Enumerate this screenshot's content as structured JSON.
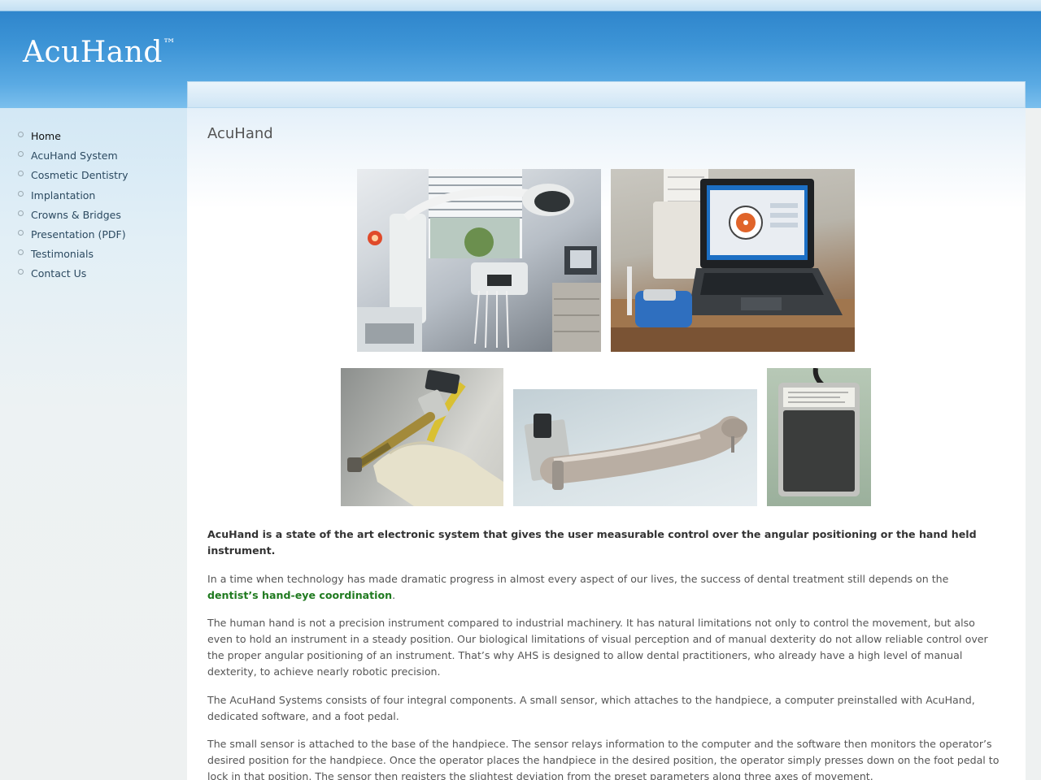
{
  "site": {
    "logo_text": "AcuHand",
    "logo_tm": "™"
  },
  "nav": {
    "items": [
      {
        "label": "Home",
        "active": true
      },
      {
        "label": "AcuHand System"
      },
      {
        "label": "Cosmetic Dentistry"
      },
      {
        "label": "Implantation"
      },
      {
        "label": "Crowns & Bridges"
      },
      {
        "label": "Presentation (PDF)"
      },
      {
        "label": "Testimonials"
      },
      {
        "label": "Contact Us"
      }
    ]
  },
  "main": {
    "title": "AcuHand",
    "lead": "AcuHand is a state of the art electronic system that gives the user measurable control over the angular positioning or the hand held instrument.",
    "p1_before": "In a time when technology has made dramatic progress in almost every aspect of our lives, the success of dental treatment still depends on the ",
    "p1_link": "dentist’s hand-eye coordination",
    "p1_after": ".",
    "p2": "The human hand is not a precision instrument compared to industrial machinery. It has natural limitations not only to control the movement, but also even to hold an instrument in a steady position. Our biological limitations of visual perception and of manual dexterity do not allow reliable control over the proper angular positioning of an instrument. That’s why AHS is designed to allow dental practitioners, who already have a high level of manual dexterity, to achieve nearly robotic precision.",
    "p3": "The AcuHand Systems consists of four integral components. A small sensor, which attaches to the handpiece, a computer preinstalled with AcuHand, dedicated software, and a foot pedal.",
    "p4": "The small sensor is attached to the base of the handpiece. The sensor relays information to the computer and the software then monitors the operator’s desired position for the handpiece. Once the operator places the handpiece in the desired position, the operator simply presses down on the foot pedal to lock in that position. The sensor then registers the slightest deviation from the preset parameters along three axes of movement."
  },
  "colors": {
    "header_blue": "#3d94d6",
    "link_green": "#1f7a1f"
  }
}
